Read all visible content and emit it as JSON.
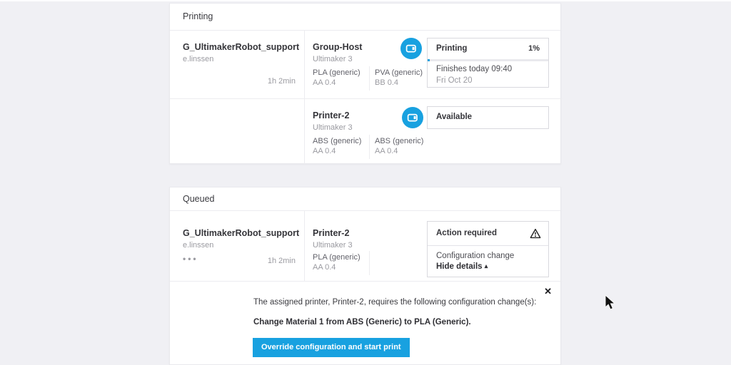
{
  "colors": {
    "accent": "#18a1e0",
    "background": "#f0f0f4"
  },
  "printing": {
    "title": "Printing",
    "job": {
      "name": "G_UltimakerRobot_support",
      "owner": "e.linssen",
      "duration": "1h 2min"
    },
    "host": {
      "name": "Group-Host",
      "model": "Ultimaker 3",
      "materials": [
        {
          "name": "PLA (generic)",
          "core": "AA 0.4"
        },
        {
          "name": "PVA (generic)",
          "core": "BB 0.4"
        }
      ],
      "status": {
        "label": "Printing",
        "progress": "1%",
        "finish": "Finishes today 09:40",
        "date": "Fri Oct 20"
      }
    },
    "printer2": {
      "name": "Printer-2",
      "model": "Ultimaker 3",
      "materials": [
        {
          "name": "ABS (generic)",
          "core": "AA 0.4"
        },
        {
          "name": "ABS (generic)",
          "core": "AA 0.4"
        }
      ],
      "status": {
        "label": "Available"
      }
    }
  },
  "queued": {
    "title": "Queued",
    "job": {
      "name": "G_UltimakerRobot_support",
      "owner": "e.linssen",
      "menu": "•••",
      "duration": "1h 2min"
    },
    "printer": {
      "name": "Printer-2",
      "model": "Ultimaker 3",
      "materials": [
        {
          "name": "PLA (generic)",
          "core": "AA 0.4"
        }
      ]
    },
    "status": {
      "label": "Action required",
      "detail": "Configuration change",
      "toggle": "Hide details",
      "toggle_icon": "▴"
    },
    "details": {
      "close": "✕",
      "message": "The assigned printer, Printer-2, requires the following configuration change(s):",
      "change": "Change Material 1 from ABS (Generic) to PLA (Generic).",
      "button": "Override configuration and start print"
    }
  }
}
